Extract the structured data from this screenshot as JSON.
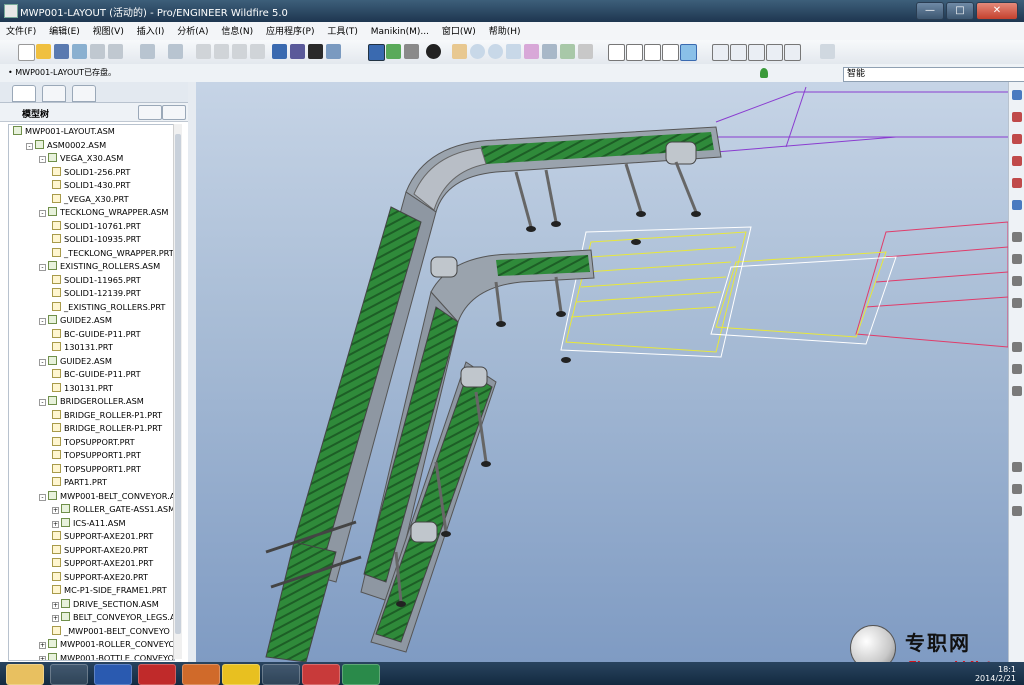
{
  "window": {
    "title": "MWP001-LAYOUT (活动的) - Pro/ENGINEER Wildfire 5.0",
    "buttons": [
      "—",
      "□",
      "✕"
    ]
  },
  "menu": [
    "文件(F)",
    "编辑(E)",
    "视图(V)",
    "插入(I)",
    "分析(A)",
    "信息(N)",
    "应用程序(P)",
    "工具(T)",
    "Manikin(M)...",
    "窗口(W)",
    "帮助(H)"
  ],
  "status": {
    "message": "MWP001-LAYOUT已存盘。",
    "filter_value": "智能"
  },
  "tree": {
    "header": "模型树",
    "items": [
      {
        "label": "MWP001-LAYOUT.ASM",
        "level": 0,
        "kind": "asm"
      },
      {
        "label": "ASM0002.ASM",
        "level": 1,
        "kind": "asm",
        "toggle": "-"
      },
      {
        "label": "VEGA_X30.ASM",
        "level": 2,
        "kind": "asm",
        "toggle": "-"
      },
      {
        "label": "SOLID1-256.PRT",
        "level": 3,
        "kind": "prt"
      },
      {
        "label": "SOLID1-430.PRT",
        "level": 3,
        "kind": "prt"
      },
      {
        "label": "_VEGA_X30.PRT",
        "level": 3,
        "kind": "prt"
      },
      {
        "label": "TECKLONG_WRAPPER.ASM",
        "level": 2,
        "kind": "asm",
        "toggle": "-"
      },
      {
        "label": "SOLID1-10761.PRT",
        "level": 3,
        "kind": "prt"
      },
      {
        "label": "SOLID1-10935.PRT",
        "level": 3,
        "kind": "prt"
      },
      {
        "label": "_TECKLONG_WRAPPER.PRT",
        "level": 3,
        "kind": "prt"
      },
      {
        "label": "EXISTING_ROLLERS.ASM",
        "level": 2,
        "kind": "asm",
        "toggle": "-"
      },
      {
        "label": "SOLID1-11965.PRT",
        "level": 3,
        "kind": "prt"
      },
      {
        "label": "SOLID1-12139.PRT",
        "level": 3,
        "kind": "prt"
      },
      {
        "label": "_EXISTING_ROLLERS.PRT",
        "level": 3,
        "kind": "prt"
      },
      {
        "label": "GUIDE2.ASM",
        "level": 2,
        "kind": "asm",
        "toggle": "-"
      },
      {
        "label": "BC-GUIDE-P11.PRT",
        "level": 3,
        "kind": "prt"
      },
      {
        "label": "130131.PRT",
        "level": 3,
        "kind": "prt"
      },
      {
        "label": "GUIDE2.ASM",
        "level": 2,
        "kind": "asm",
        "toggle": "-"
      },
      {
        "label": "BC-GUIDE-P11.PRT",
        "level": 3,
        "kind": "prt"
      },
      {
        "label": "130131.PRT",
        "level": 3,
        "kind": "prt"
      },
      {
        "label": "BRIDGEROLLER.ASM",
        "level": 2,
        "kind": "asm",
        "toggle": "-"
      },
      {
        "label": "BRIDGE_ROLLER-P1.PRT",
        "level": 3,
        "kind": "prt"
      },
      {
        "label": "BRIDGE_ROLLER-P1.PRT",
        "level": 3,
        "kind": "prt"
      },
      {
        "label": "TOPSUPPORT.PRT",
        "level": 3,
        "kind": "prt"
      },
      {
        "label": "TOPSUPPORT1.PRT",
        "level": 3,
        "kind": "prt"
      },
      {
        "label": "TOPSUPPORT1.PRT",
        "level": 3,
        "kind": "prt"
      },
      {
        "label": "PART1.PRT",
        "level": 3,
        "kind": "prt"
      },
      {
        "label": "MWP001-BELT_CONVEYOR.AS",
        "level": 2,
        "kind": "asm",
        "toggle": "-"
      },
      {
        "label": "ROLLER_GATE-ASS1.ASM",
        "level": 3,
        "kind": "asm",
        "toggle": "+"
      },
      {
        "label": "ICS-A11.ASM",
        "level": 3,
        "kind": "asm",
        "toggle": "+"
      },
      {
        "label": "SUPPORT-AXE201.PRT",
        "level": 3,
        "kind": "prt"
      },
      {
        "label": "SUPPORT-AXE20.PRT",
        "level": 3,
        "kind": "prt"
      },
      {
        "label": "SUPPORT-AXE201.PRT",
        "level": 3,
        "kind": "prt"
      },
      {
        "label": "SUPPORT-AXE20.PRT",
        "level": 3,
        "kind": "prt"
      },
      {
        "label": "MC-P1-SIDE_FRAME1.PRT",
        "level": 3,
        "kind": "prt"
      },
      {
        "label": "DRIVE_SECTION.ASM",
        "level": 3,
        "kind": "asm",
        "toggle": "+"
      },
      {
        "label": "BELT_CONVEYOR_LEGS.AS",
        "level": 3,
        "kind": "asm",
        "toggle": "+"
      },
      {
        "label": "_MWP001-BELT_CONVEYO",
        "level": 3,
        "kind": "prt"
      },
      {
        "label": "MWP001-ROLLER_CONVEYOR",
        "level": 2,
        "kind": "asm",
        "toggle": "+"
      },
      {
        "label": "MWP001-BOTTLE_CONVEYOR",
        "level": 2,
        "kind": "asm",
        "toggle": "+"
      }
    ]
  },
  "taskbar": {
    "apps": [
      "explorer",
      "paint",
      "word",
      "acrobat",
      "powerpoint",
      "notepad",
      "search",
      "record",
      "proe"
    ],
    "time": "18:1",
    "date": "2014/2/21"
  },
  "watermark": {
    "cn": "专职网",
    "en": "Zhuanzhi.Net"
  },
  "colors": {
    "belt": "#2f8a3a",
    "frame": "#9aa3ad",
    "sketch_yellow": "#e8e83a",
    "sketch_red": "#e03c6a",
    "sketch_purple": "#8a3cd0"
  }
}
